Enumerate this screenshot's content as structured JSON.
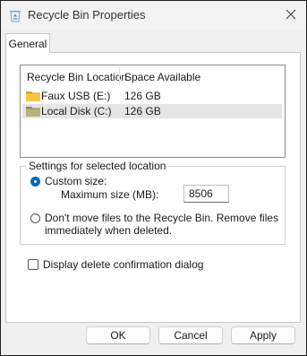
{
  "window": {
    "title": "Recycle Bin Properties",
    "app_icon": "recycle-bin-icon",
    "close_icon": "close-icon"
  },
  "tabs": [
    {
      "label": "General"
    }
  ],
  "list": {
    "columns": [
      "Recycle Bin Location",
      "Space Available"
    ],
    "rows": [
      {
        "name": "Faux USB (E:)",
        "space": "126 GB",
        "icon": "folder-icon",
        "selected": false
      },
      {
        "name": "Local Disk (C:)",
        "space": "126 GB",
        "icon": "folder-icon",
        "selected": true
      }
    ]
  },
  "settings": {
    "group_title": "Settings for selected location",
    "custom_size_label": "Custom size:",
    "max_size_label": "Maximum size (MB):",
    "max_size_value": "8506",
    "custom_size_selected": true,
    "dont_move_line1": "Don't move files to the Recycle Bin. Remove files",
    "dont_move_line2": "immediately when deleted.",
    "dont_move_selected": false
  },
  "confirm_dialog": {
    "label": "Display delete confirmation dialog",
    "checked": false
  },
  "buttons": {
    "ok": "OK",
    "cancel": "Cancel",
    "apply": "Apply"
  },
  "colors": {
    "accent": "#0067c0",
    "folder": "#f5c542",
    "folder_dark": "#d9a520",
    "selection": "#e5e5e5"
  }
}
